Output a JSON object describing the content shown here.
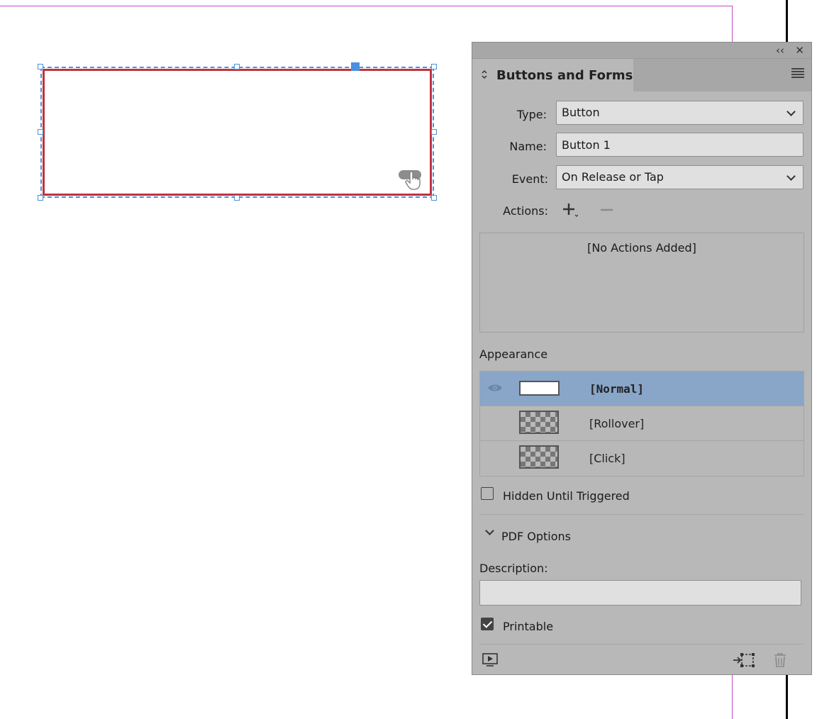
{
  "panel": {
    "title": "Buttons and Forms",
    "collapse_glyph": "‹‹",
    "close_glyph": "✕",
    "type": {
      "label": "Type:",
      "value": "Button"
    },
    "name": {
      "label": "Name:",
      "value": "Button 1"
    },
    "event": {
      "label": "Event:",
      "value": "On Release or Tap"
    },
    "actions": {
      "label": "Actions:",
      "add_glyph": "+",
      "remove_glyph": "−",
      "empty_text": "[No Actions Added]"
    },
    "appearance": {
      "label": "Appearance",
      "states": [
        {
          "label": "[Normal]",
          "selected": true
        },
        {
          "label": "[Rollover]",
          "selected": false
        },
        {
          "label": "[Click]",
          "selected": false
        }
      ]
    },
    "hidden_until_triggered": {
      "label": "Hidden Until Triggered",
      "checked": false
    },
    "pdf_options": {
      "label": "PDF Options",
      "expanded": true
    },
    "description": {
      "label": "Description:",
      "value": ""
    },
    "printable": {
      "label": "Printable",
      "checked": true
    },
    "footer_icons": [
      "preview-icon",
      "convert-to-button-icon",
      "trash-icon"
    ]
  },
  "colors": {
    "panel_bg": "#b8b8b8",
    "selection_blue": "#4a8fe0",
    "button_stroke": "#c0323e",
    "selected_row": "#89a5c8",
    "guide_magenta": "#c04ac4"
  }
}
